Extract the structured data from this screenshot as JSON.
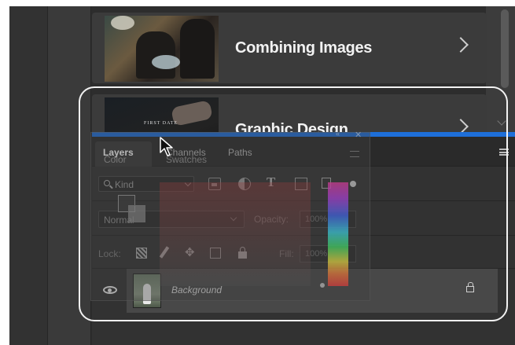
{
  "learn_cards": [
    {
      "title": "Combining Images",
      "thumbnail": "photo-people-at-workbench"
    },
    {
      "title": "Graphic Design",
      "thumbnail": "photo-hand-dark-poster",
      "thumbnail_caption": "FIRST DATE"
    }
  ],
  "layers_panel": {
    "tabs": [
      "Layers",
      "Channels",
      "Paths"
    ],
    "active_tab": "Layers",
    "filter": {
      "label": "Kind",
      "icons": [
        "pixel-layer-filter-icon",
        "adjustment-layer-filter-icon",
        "type-layer-filter-icon",
        "shape-layer-filter-icon",
        "smart-object-filter-icon"
      ]
    },
    "blend_mode": "Normal",
    "opacity_label": "Opacity:",
    "opacity_value": "100%",
    "lock_label": "Lock:",
    "fill_label": "Fill:",
    "fill_value": "100%",
    "layers": [
      {
        "name": "Background",
        "visible": true,
        "locked": true
      }
    ]
  },
  "ghost_color_panel": {
    "tabs": [
      "Color",
      "Swatches"
    ]
  },
  "colors": {
    "drop_indicator": "#1e6fd9",
    "highlight_outline": "#f2f2f2",
    "panel_bg": "#323232"
  }
}
